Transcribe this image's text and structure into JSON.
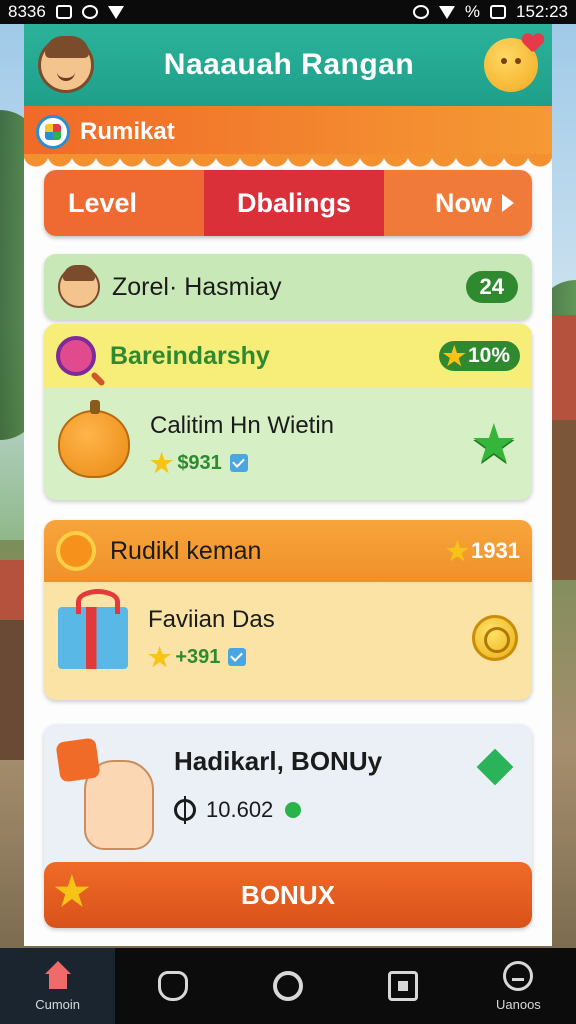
{
  "status_bar": {
    "left_text": "8336",
    "right_percent": "%",
    "time": "152:23"
  },
  "header": {
    "title": "Naaauah Rangan"
  },
  "banner": {
    "label": "Rumikat"
  },
  "tabs": [
    {
      "label": "Level"
    },
    {
      "label": "Dbalings"
    },
    {
      "label": "Now"
    }
  ],
  "user_row": {
    "name": "Zorel· Hasmiay",
    "count": "24"
  },
  "card_challenge": {
    "title": "Bareindarshy",
    "badge": "10%",
    "item_name": "Calitim Hn Wietin",
    "price": "$931"
  },
  "card_reward": {
    "title": "Rudikl keman",
    "badge": "1931",
    "item_name": "Faviian Das",
    "price": "+391"
  },
  "card_bonus": {
    "title": "Hadikarl, BONUy",
    "value": "10.602",
    "button_label": "BONUX"
  },
  "bottom_nav": [
    {
      "label": "Cumoin",
      "icon": "home-icon",
      "active": true
    },
    {
      "label": "",
      "icon": "gamepad-icon"
    },
    {
      "label": "",
      "icon": "circle-icon"
    },
    {
      "label": "",
      "icon": "square-icon"
    },
    {
      "label": "Uanoos",
      "icon": "face-icon"
    }
  ],
  "colors": {
    "header": "#1f9f8a",
    "banner": "#f06a28",
    "accent_green": "#2f8a2f",
    "accent_red": "#d9303a"
  }
}
